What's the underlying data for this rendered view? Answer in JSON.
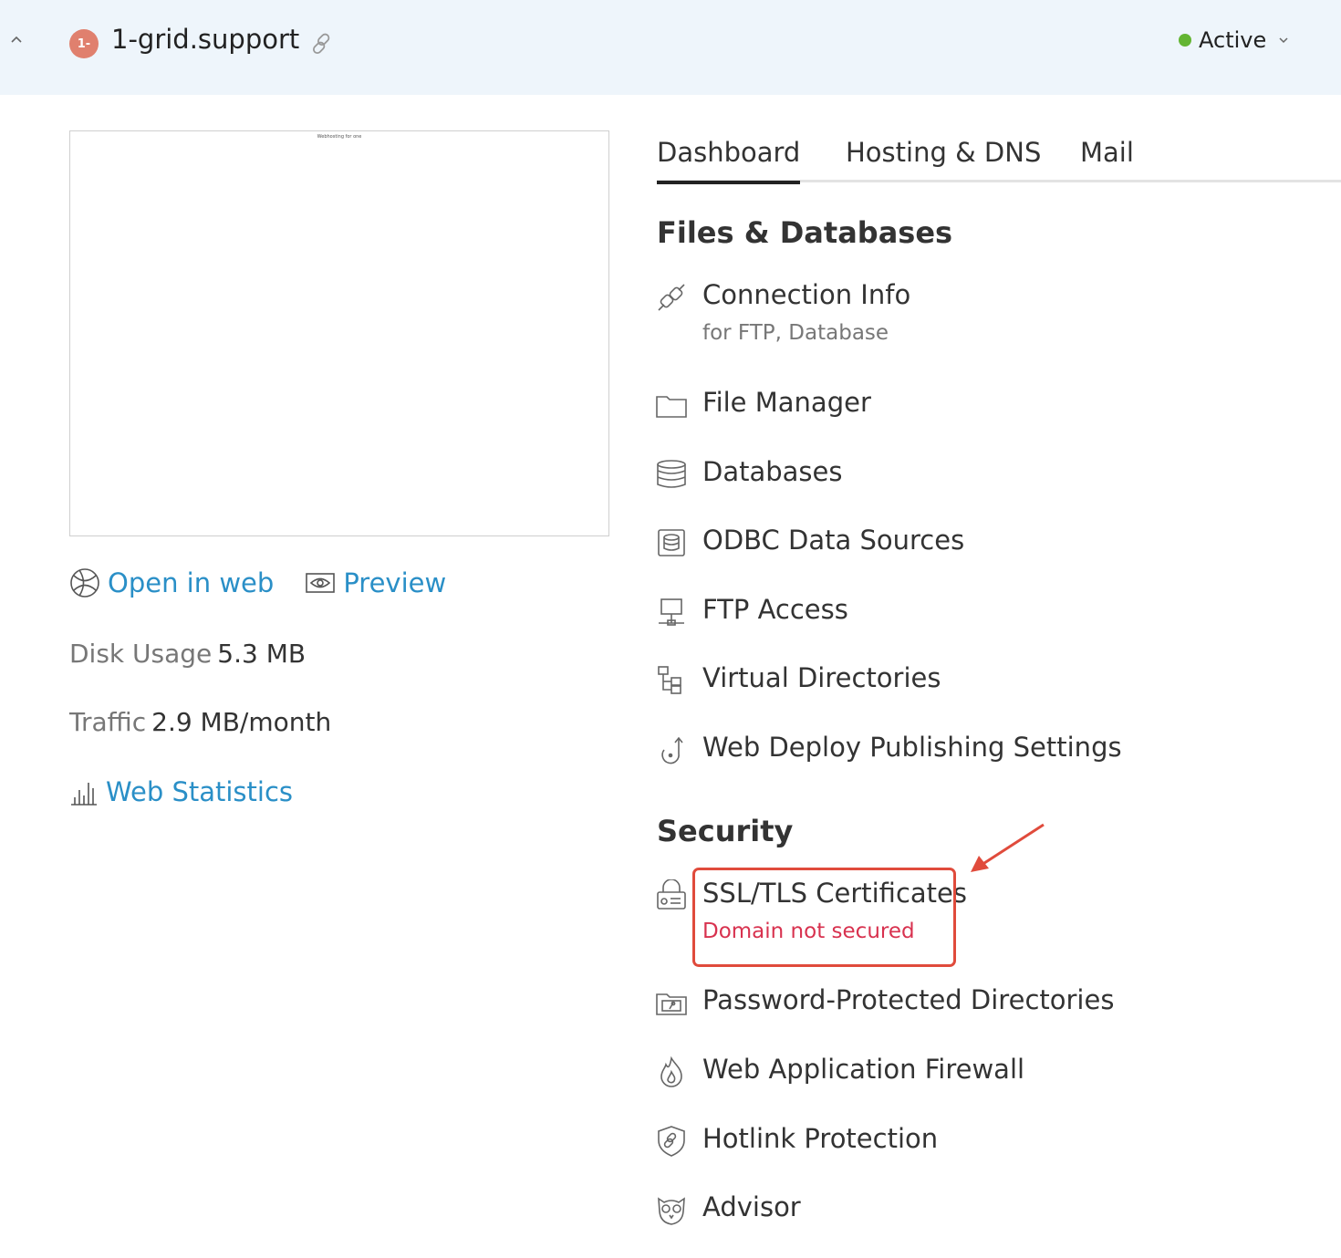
{
  "header": {
    "domain_badge": "1-",
    "domain_name": "1-grid.support",
    "status": "Active"
  },
  "thumbnail": {
    "caption": "Webhosting for one"
  },
  "links": {
    "open_in_web": "Open in web",
    "preview": "Preview",
    "web_statistics": "Web Statistics"
  },
  "stats": {
    "disk_label": "Disk Usage",
    "disk_value": "5.3 MB",
    "traffic_label": "Traffic",
    "traffic_value": "2.9 MB/month"
  },
  "tabs": [
    "Dashboard",
    "Hosting & DNS",
    "Mail"
  ],
  "sections": {
    "files": {
      "title": "Files & Databases",
      "items": [
        {
          "label": "Connection Info",
          "sub": "for FTP, Database",
          "icon": "plug-icon"
        },
        {
          "label": "File Manager",
          "icon": "folder-icon"
        },
        {
          "label": "Databases",
          "icon": "database-icon"
        },
        {
          "label": "ODBC Data Sources",
          "icon": "odbc-icon"
        },
        {
          "label": "FTP Access",
          "icon": "ftp-icon"
        },
        {
          "label": "Virtual Directories",
          "icon": "virtual-directories-icon"
        },
        {
          "label": "Web Deploy Publishing Settings",
          "icon": "web-deploy-icon"
        }
      ]
    },
    "security": {
      "title": "Security",
      "items": [
        {
          "label": "SSL/TLS Certificates",
          "sub": "Domain not secured",
          "icon": "ssl-lock-icon"
        },
        {
          "label": "Password-Protected Directories",
          "icon": "protected-folder-icon"
        },
        {
          "label": "Web Application Firewall",
          "icon": "firewall-flame-icon"
        },
        {
          "label": "Hotlink Protection",
          "icon": "hotlink-shield-icon"
        },
        {
          "label": "Advisor",
          "icon": "advisor-owl-icon"
        }
      ]
    }
  },
  "colors": {
    "header_bg": "#eef5fb",
    "link": "#2a8fc7",
    "status_active": "#63b532",
    "warning": "#d8324f",
    "highlight": "#e04b3c"
  }
}
